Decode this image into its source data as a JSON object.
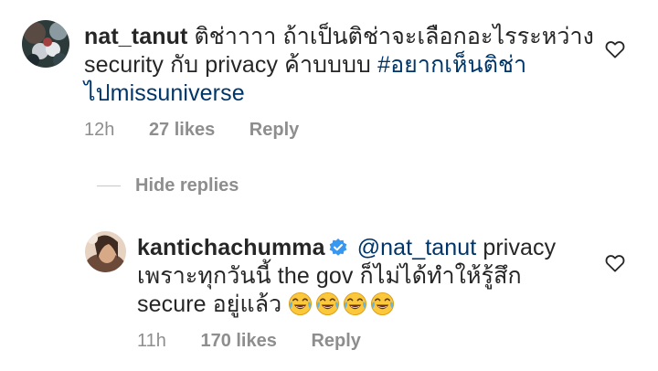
{
  "comments": [
    {
      "username": "nat_tanut",
      "text": "ติช่าาาา ถ้าเป็นติช่าจะเลือกอะไรระหว่าง security กับ privacy ค้าบบบบ",
      "hashtag": "#อยากเห็นติช่าไปmissuniverse",
      "time": "12h",
      "likes": "27 likes",
      "reply": "Reply",
      "like_icon": "heart-outline-icon"
    },
    {
      "username": "kantichachumma",
      "verified_icon": "verified-badge-icon",
      "mention": "@nat_tanut",
      "text": "privacy เพราะทุกวันนี้ the gov ก็ไม่ได้ทำให้รู้สึก secure อยู่แล้ว",
      "emoji_icon": "face-with-tears-of-joy-emoji",
      "time": "11h",
      "likes": "170 likes",
      "reply": "Reply",
      "like_icon": "heart-outline-icon"
    }
  ],
  "hide_replies_label": "Hide replies",
  "colors": {
    "text": "#262626",
    "meta": "#8e8e8e",
    "link": "#003569",
    "verified": "#3897f0"
  }
}
